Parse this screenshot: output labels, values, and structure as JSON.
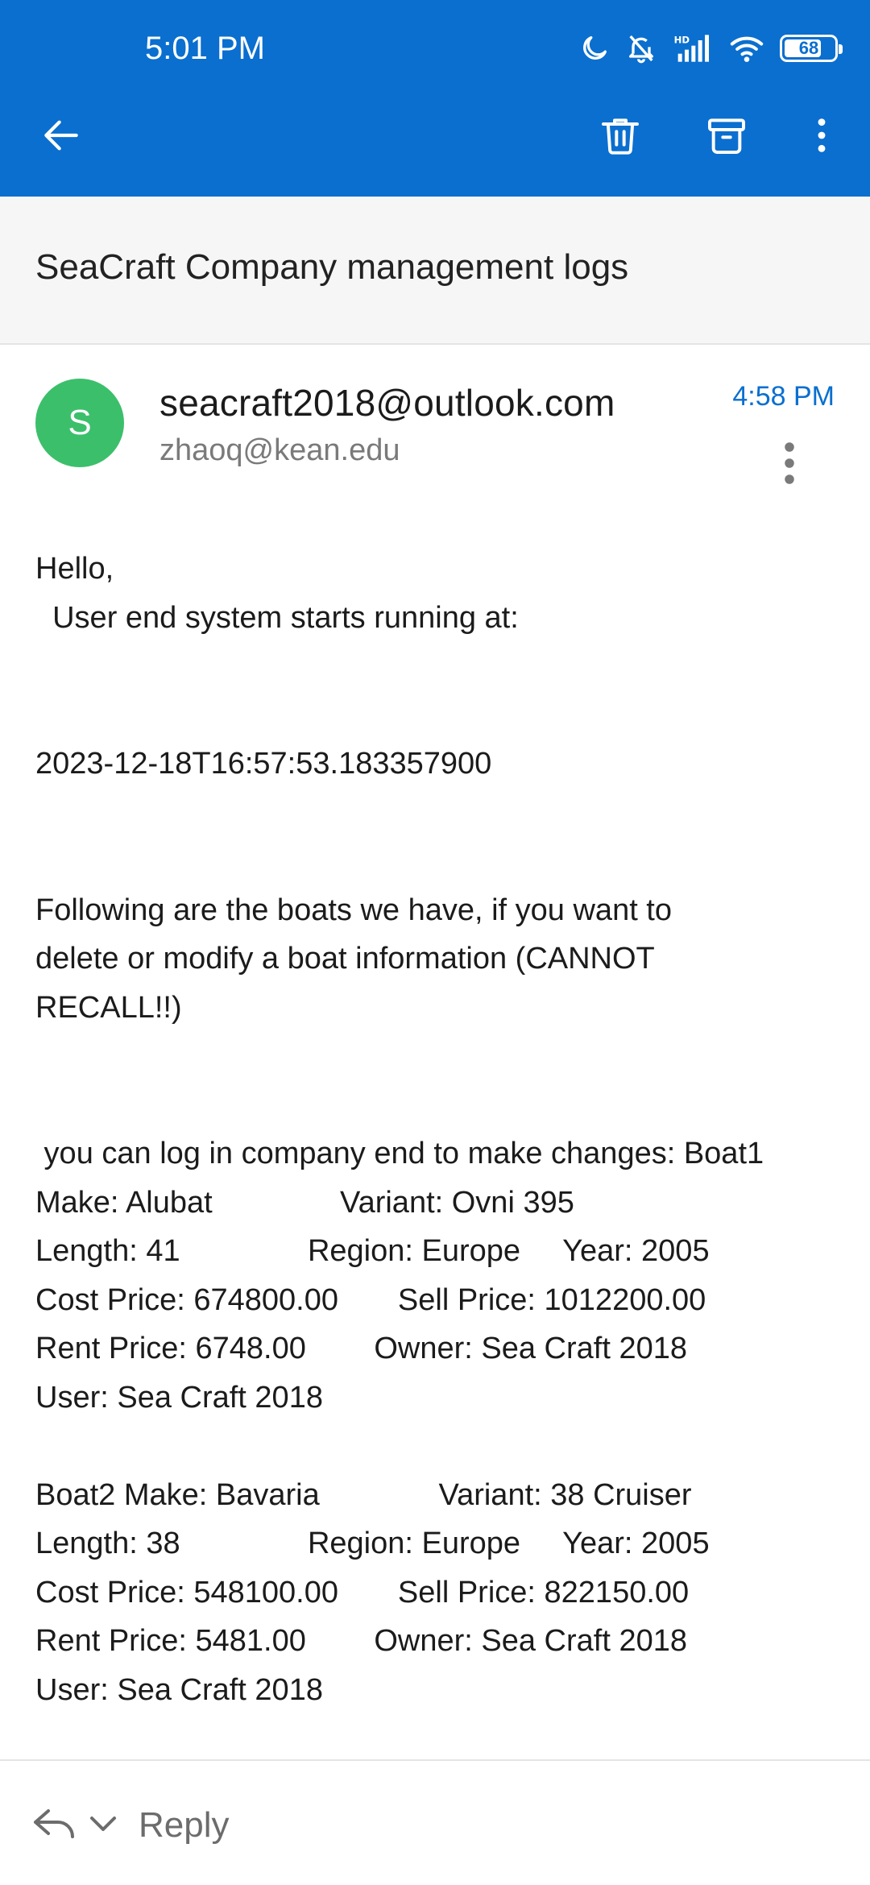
{
  "status_bar": {
    "time": "5:01 PM",
    "battery": "68",
    "icons": [
      "moon-icon",
      "bell-off-icon",
      "hd-signal-icon",
      "wifi-icon",
      "battery-icon"
    ]
  },
  "toolbar": {
    "back_icon": "arrow-left-icon",
    "delete_icon": "trash-icon",
    "archive_icon": "archive-icon",
    "more_icon": "more-vertical-icon"
  },
  "subject": "SeaCraft Company management logs",
  "message": {
    "avatar_letter": "S",
    "sender": "seacraft2018@outlook.com",
    "recipient": "zhaoq@kean.edu",
    "time": "4:58 PM",
    "body_lines": [
      "Hello,",
      "  User end system starts running at:",
      "",
      "",
      "2023-12-18T16:57:53.183357900",
      "",
      "",
      "Following are the boats we have, if you want to",
      "delete or modify a boat information (CANNOT",
      "RECALL!!)",
      "",
      "",
      " you can log in company end to make changes: Boat1",
      "Make: Alubat               Variant: Ovni 395",
      "Length: 41               Region: Europe     Year: 2005",
      "Cost Price: 674800.00       Sell Price: 1012200.00",
      "Rent Price: 6748.00        Owner: Sea Craft 2018",
      "User: Sea Craft 2018",
      "",
      "Boat2 Make: Bavaria              Variant: 38 Cruiser",
      "Length: 38               Region: Europe     Year: 2005",
      "Cost Price: 548100.00       Sell Price: 822150.00",
      "Rent Price: 5481.00        Owner: Sea Craft 2018",
      "User: Sea Craft 2018"
    ]
  },
  "bottom_bar": {
    "reply_label": "Reply",
    "reply_icon": "reply-icon",
    "chevron_icon": "chevron-down-icon"
  },
  "colors": {
    "header": "#0a6fcf",
    "avatar": "#3cbf6b",
    "accent_time": "#0a6fcf"
  }
}
